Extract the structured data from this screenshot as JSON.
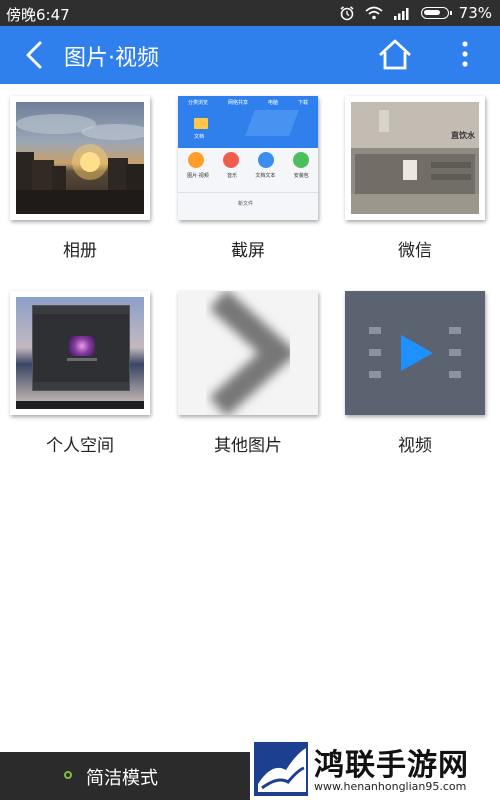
{
  "status_bar": {
    "time": "傍晚6:47",
    "battery": "73%",
    "battery_level": 0.73
  },
  "app_bar": {
    "title": "图片·视频",
    "back_icon": "back-arrow-icon",
    "home_icon": "home-icon",
    "more_icon": "more-vertical-icon"
  },
  "folders": [
    {
      "label": "相册",
      "thumb": "sunset-photo"
    },
    {
      "label": "截屏",
      "thumb": "screenshot-app"
    },
    {
      "label": "微信",
      "thumb": "room-photo"
    },
    {
      "label": "个人空间",
      "thumb": "desktop-dialog"
    },
    {
      "label": "其他图片",
      "thumb": "blurred-chevron"
    },
    {
      "label": "视频",
      "thumb": "video-play"
    }
  ],
  "screenshot_thumb": {
    "tabs": [
      "分类浏览",
      "网络共享",
      "电脑",
      "下载"
    ],
    "folder_label": "文档",
    "apps": [
      "图片·视频",
      "音乐",
      "文档文本",
      "安装包"
    ],
    "bottom_label": "新文件"
  },
  "room_thumb": {
    "sign": "直饮水"
  },
  "bottom": {
    "simple_mode": "简洁模式"
  },
  "watermark": {
    "title": "鸿联手游网",
    "url": "www.henanhonglian95.com"
  },
  "colors": {
    "app_bar": "#2f80ed",
    "status_bar": "#2f2f2f",
    "play_icon": "#1e90ff"
  }
}
